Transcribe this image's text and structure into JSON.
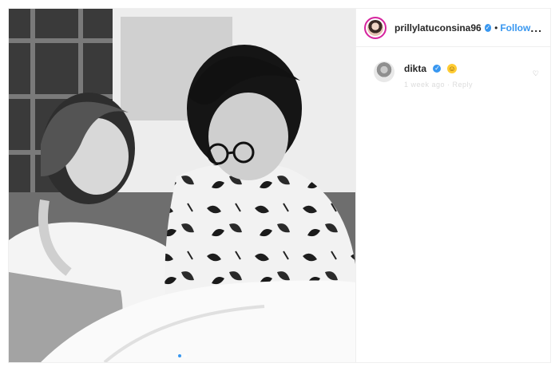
{
  "post": {
    "author": {
      "username": "prillylatuconsina96",
      "verified_icon": "verified-badge-icon",
      "separator": "•",
      "follow_label": "Follow",
      "more_label": "..."
    },
    "media": {
      "description_icon": "photo",
      "carousel_dots": 2,
      "active_dot": 0
    },
    "comments": [
      {
        "username": "dikta",
        "verified_icon": "verified-badge-icon",
        "emoji": "☺",
        "meta": "1 week ago   ·   Reply"
      }
    ]
  },
  "colors": {
    "accent": "#3897f0",
    "text": "#262626",
    "story_ring": "#d6249f"
  }
}
